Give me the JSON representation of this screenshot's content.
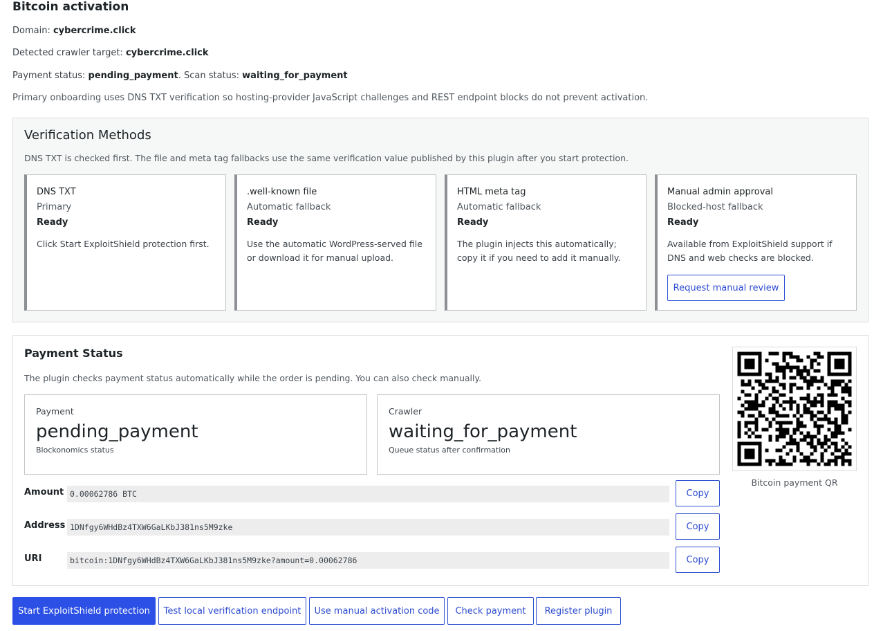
{
  "header": {
    "title": "Bitcoin activation",
    "domain_label": "Domain:",
    "domain_value": "cybercrime.click",
    "crawler_label": "Detected crawler target:",
    "crawler_value": "cybercrime.click",
    "payment_status_label": "Payment status:",
    "payment_status_value": "pending_payment",
    "scan_status_label": ". Scan status:",
    "scan_status_value": "waiting_for_payment",
    "note": "Primary onboarding uses DNS TXT verification so hosting-provider JavaScript challenges and REST endpoint blocks do not prevent activation."
  },
  "verification": {
    "title": "Verification Methods",
    "description": "DNS TXT is checked first. The file and meta tag fallbacks use the same verification value published by this plugin after you start protection.",
    "cards": [
      {
        "title": "DNS TXT",
        "subtitle": "Primary",
        "state": "Ready",
        "detail": "Click Start ExploitShield protection first."
      },
      {
        "title": ".well-known file",
        "subtitle": "Automatic fallback",
        "state": "Ready",
        "detail": "Use the automatic WordPress-served file or download it for manual upload."
      },
      {
        "title": "HTML meta tag",
        "subtitle": "Automatic fallback",
        "state": "Ready",
        "detail": "The plugin injects this automatically; copy it if you need to add it manually."
      },
      {
        "title": "Manual admin approval",
        "subtitle": "Blocked-host fallback",
        "state": "Ready",
        "detail": "Available from ExploitShield support if DNS and web checks are blocked.",
        "button": "Request manual review"
      }
    ]
  },
  "payment": {
    "title": "Payment Status",
    "description": "The plugin checks payment status automatically while the order is pending. You can also check manually.",
    "payment_box": {
      "label": "Payment",
      "value": "pending_payment",
      "sub": "Blockonomics status"
    },
    "crawler_box": {
      "label": "Crawler",
      "value": "waiting_for_payment",
      "sub": "Queue status after confirmation"
    },
    "rows": [
      {
        "label": "Amount",
        "value": "0.00062786 BTC",
        "button": "Copy"
      },
      {
        "label": "Address",
        "value": "1DNfgy6WHdBz4TXW6GaLKbJ381ns5M9zke",
        "button": "Copy"
      },
      {
        "label": "URI",
        "value": "bitcoin:1DNfgy6WHdBz4TXW6GaLKbJ381ns5M9zke?amount=0.00062786",
        "button": "Copy"
      }
    ],
    "qr_caption": "Bitcoin payment QR"
  },
  "actions": {
    "start": "Start ExploitShield protection",
    "test_endpoint": "Test local verification endpoint",
    "manual_code": "Use manual activation code",
    "check_payment": "Check payment",
    "register": "Register plugin"
  },
  "colors": {
    "primary": "#2c50e6",
    "outline": "#2d4fd0",
    "card_accent": "#8c8f94"
  }
}
